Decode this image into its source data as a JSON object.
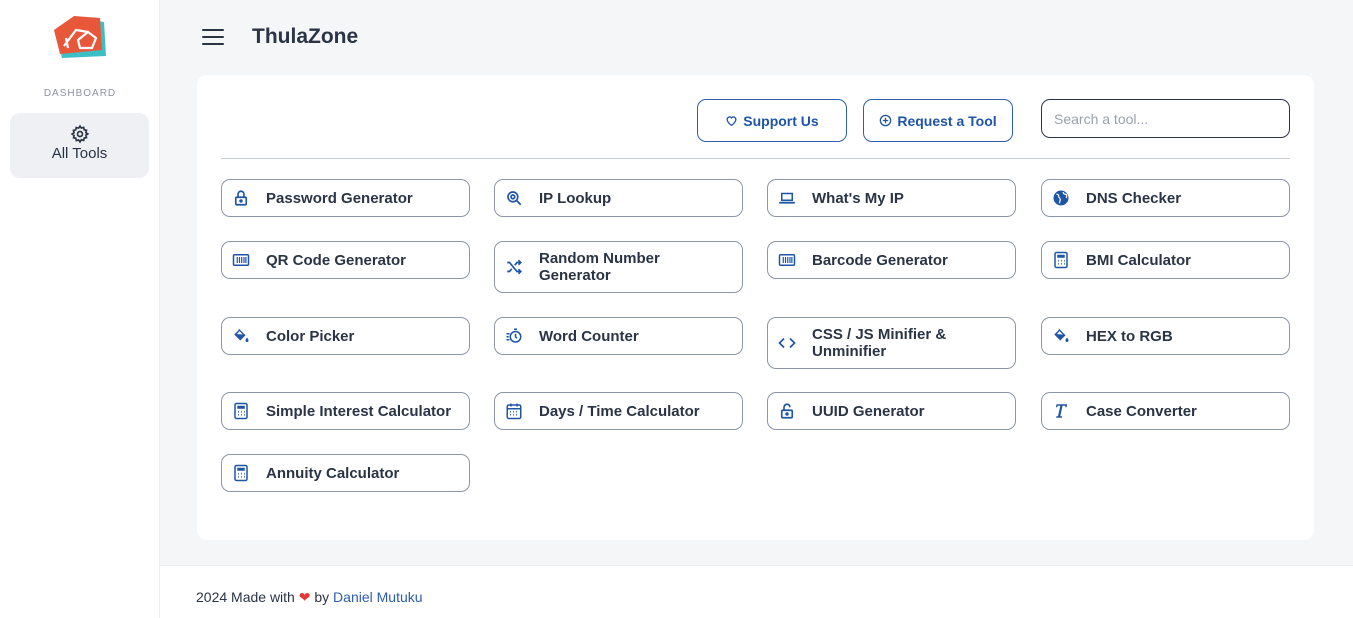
{
  "sidebar": {
    "heading": "DASHBOARD",
    "items": [
      {
        "label": "All Tools",
        "icon": "gear-icon"
      }
    ]
  },
  "header": {
    "title": "ThulaZone"
  },
  "actions": {
    "support_label": "Support Us",
    "request_label": "Request a Tool",
    "search_placeholder": "Search a tool..."
  },
  "tools": [
    {
      "label": "Password Generator",
      "icon": "lock-icon"
    },
    {
      "label": "IP Lookup",
      "icon": "search-icon"
    },
    {
      "label": "What's My IP",
      "icon": "laptop-icon"
    },
    {
      "label": "DNS Checker",
      "icon": "globe-icon"
    },
    {
      "label": "QR Code Generator",
      "icon": "barcode-icon"
    },
    {
      "label": "Random Number Generator",
      "icon": "shuffle-icon"
    },
    {
      "label": "Barcode Generator",
      "icon": "barcode-icon"
    },
    {
      "label": "BMI Calculator",
      "icon": "calculator-icon"
    },
    {
      "label": "Color Picker",
      "icon": "paint-bucket-icon"
    },
    {
      "label": "Word Counter",
      "icon": "timer-icon"
    },
    {
      "label": "CSS / JS Minifier & Unminifier",
      "icon": "code-icon"
    },
    {
      "label": "HEX to RGB",
      "icon": "paint-bucket-icon"
    },
    {
      "label": "Simple Interest Calculator",
      "icon": "calculator-icon"
    },
    {
      "label": "Days / Time Calculator",
      "icon": "calendar-icon"
    },
    {
      "label": "UUID Generator",
      "icon": "unlock-icon"
    },
    {
      "label": "Case Converter",
      "icon": "text-icon"
    },
    {
      "label": "Annuity Calculator",
      "icon": "calculator-icon"
    }
  ],
  "footer": {
    "prefix": "2024 Made with",
    "middle": "by",
    "author": "Daniel Mutuku"
  },
  "colors": {
    "accent": "#1f55a6",
    "logo_orange": "#e8573a",
    "logo_teal": "#3bbfc4",
    "heart": "#e53935"
  }
}
